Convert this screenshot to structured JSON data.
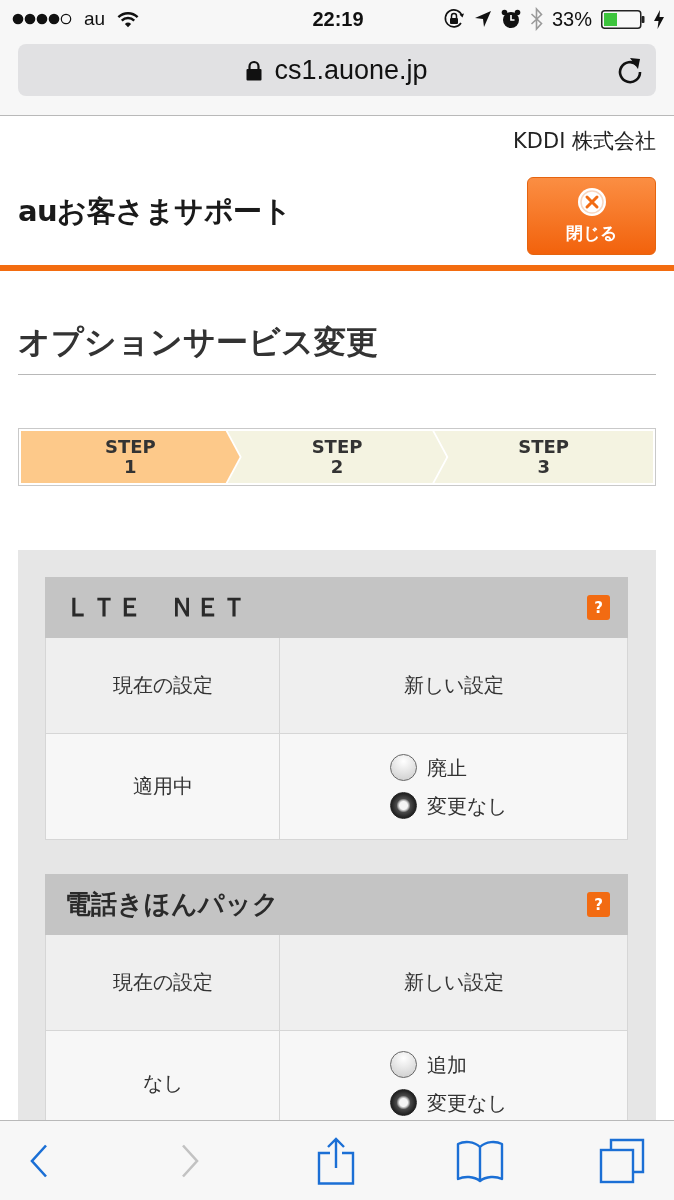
{
  "status_bar": {
    "carrier": "au",
    "time": "22:19",
    "battery": "33%"
  },
  "address_bar": {
    "url": "cs1.auone.jp"
  },
  "header": {
    "company": "KDDI 株式会社",
    "logo": "auお客さまサポート",
    "close_button": "閉じる"
  },
  "page_title": "オプションサービス変更",
  "steps": [
    {
      "label": "STEP",
      "number": "1",
      "selected": true
    },
    {
      "label": "STEP",
      "number": "2",
      "selected": false
    },
    {
      "label": "STEP",
      "number": "3",
      "selected": false
    }
  ],
  "options": [
    {
      "title": "ＬＴＥ　ＮＥＴ",
      "help": "?",
      "columns": [
        "現在の設定",
        "新しい設定"
      ],
      "current": "適用中",
      "choices": [
        {
          "label": "廃止",
          "selected": false
        },
        {
          "label": "変更なし",
          "selected": true
        }
      ]
    },
    {
      "title": "電話きほんパック",
      "help": "?",
      "columns": [
        "現在の設定",
        "新しい設定"
      ],
      "current": "なし",
      "choices": [
        {
          "label": "追加",
          "selected": false
        },
        {
          "label": "変更なし",
          "selected": true
        }
      ]
    }
  ],
  "toolbar": [
    {
      "kind": "back",
      "disabled": false
    },
    {
      "kind": "forward",
      "disabled": true
    },
    {
      "kind": "share",
      "disabled": false
    },
    {
      "kind": "bookmarks",
      "disabled": false
    },
    {
      "kind": "tabs",
      "disabled": false
    }
  ]
}
